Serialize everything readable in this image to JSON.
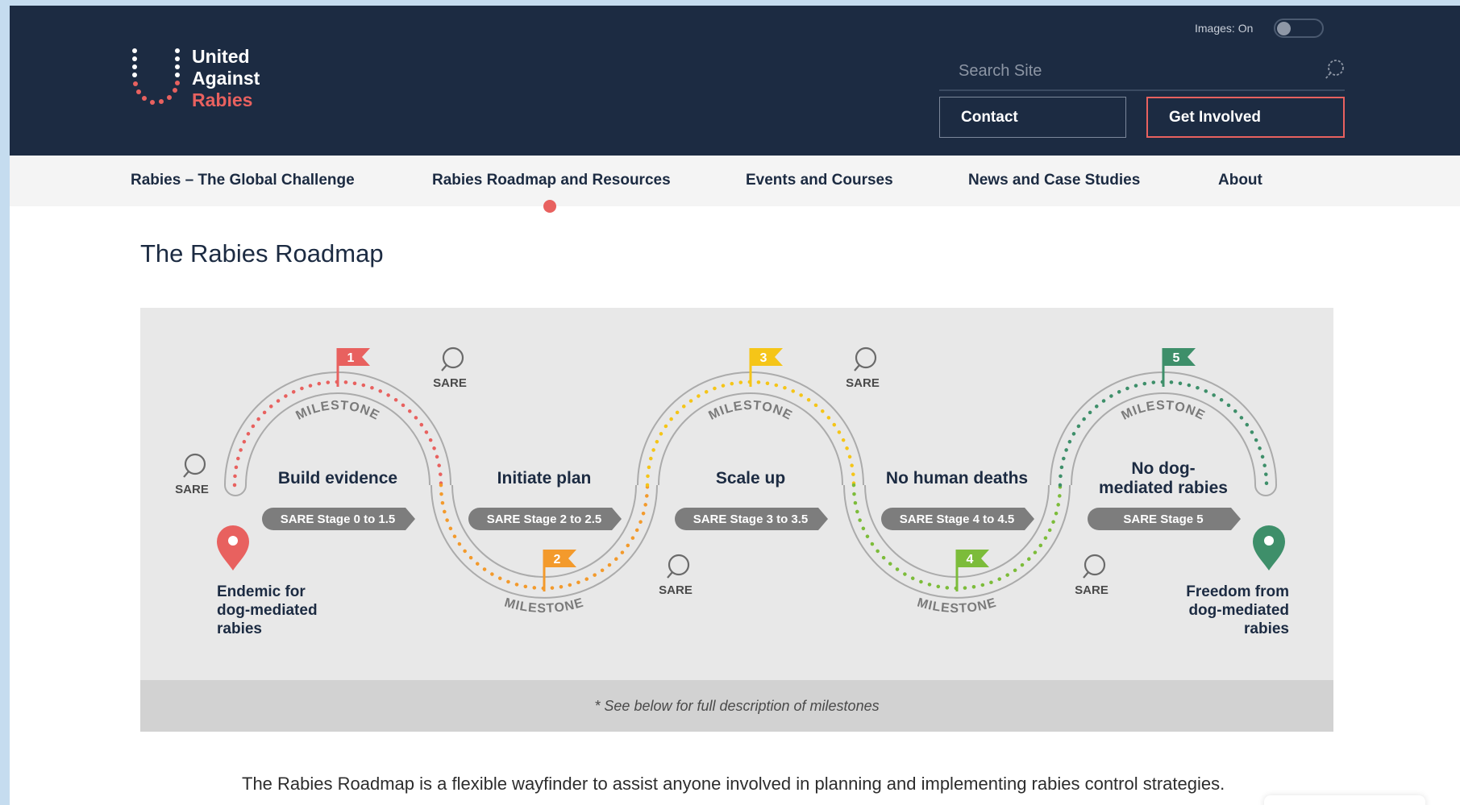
{
  "header": {
    "logo": {
      "line1": "United",
      "line2": "Against",
      "line3": "Rabies"
    },
    "images_toggle": {
      "label": "Images: On"
    },
    "search": {
      "placeholder": "Search Site"
    },
    "buttons": {
      "contact": "Contact",
      "get_involved": "Get Involved"
    }
  },
  "nav": {
    "items": [
      {
        "label": "Rabies – The Global Challenge"
      },
      {
        "label": "Rabies Roadmap and Resources",
        "active": true
      },
      {
        "label": "Events and Courses"
      },
      {
        "label": "News and Case Studies"
      },
      {
        "label": "About"
      }
    ]
  },
  "page": {
    "title": "The Rabies Roadmap"
  },
  "roadmap": {
    "start_label": [
      "Endemic for",
      "dog-mediated",
      "rabies"
    ],
    "end_label": [
      "Freedom from",
      "dog-mediated",
      "rabies"
    ],
    "stages": [
      {
        "title": [
          "Build evidence"
        ],
        "badge": "SARE Stage 0 to 1.5"
      },
      {
        "title": [
          "Initiate plan"
        ],
        "badge": "SARE Stage 2 to 2.5"
      },
      {
        "title": [
          "Scale up"
        ],
        "badge": "SARE Stage 3 to 3.5"
      },
      {
        "title": [
          "No human deaths"
        ],
        "badge": "SARE Stage 4 to 4.5"
      },
      {
        "title": [
          "No dog-",
          "mediated rabies"
        ],
        "badge": "SARE Stage 5"
      }
    ],
    "flags": [
      "1",
      "2",
      "3",
      "4",
      "5"
    ],
    "milestone_label": "MILESTONE",
    "sare_label": "SARE",
    "colors": {
      "stage1": "#e8615f",
      "stage2": "#f39a2c",
      "stage3": "#f5c518",
      "stage4": "#7cbc3a",
      "stage5": "#3e8f6a",
      "badge": "#7d7d7d",
      "track": "#ababab"
    }
  },
  "footnote": "* See below for full description of milestones",
  "intro": "The Rabies Roadmap is a flexible wayfinder to assist anyone involved in planning and implementing rabies control strategies."
}
